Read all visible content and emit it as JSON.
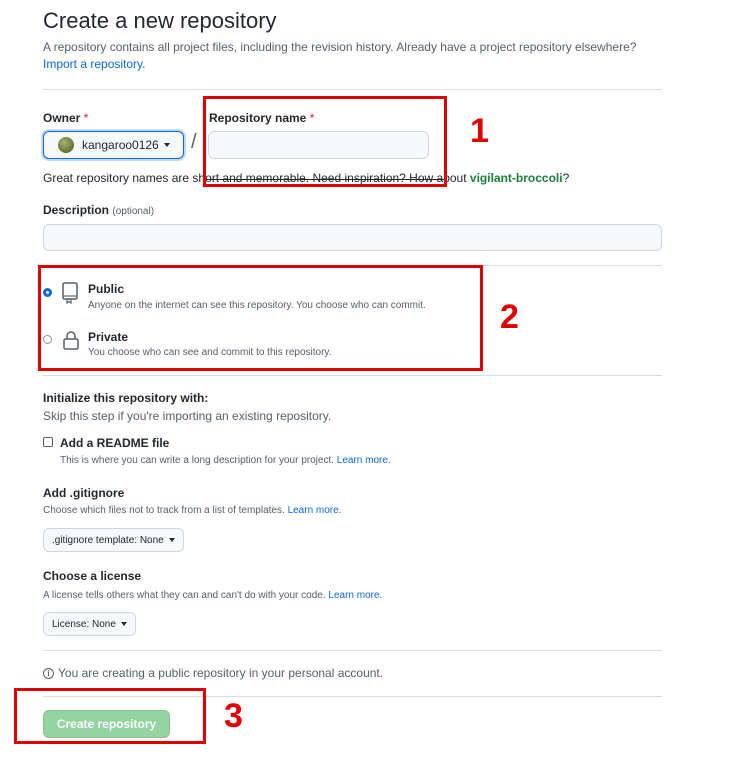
{
  "header": {
    "title": "Create a new repository",
    "description": "A repository contains all project files, including the revision history. Already have a project repository elsewhere?",
    "import_link": "Import a repository."
  },
  "owner": {
    "label": "Owner",
    "required_mark": "*",
    "value": "kangaroo0126"
  },
  "repo_name": {
    "label": "Repository name",
    "required_mark": "*",
    "separator": "/",
    "value": ""
  },
  "name_hint": {
    "text": "Great repository names are short and memorable. Need inspiration? How about ",
    "suggestion": "vigilant-broccoli",
    "suffix": "?"
  },
  "description": {
    "label": "Description",
    "optional": "(optional)",
    "value": ""
  },
  "visibility": {
    "selected": "public",
    "options": [
      {
        "id": "public",
        "title": "Public",
        "desc": "Anyone on the internet can see this repository. You choose who can commit."
      },
      {
        "id": "private",
        "title": "Private",
        "desc": "You choose who can see and commit to this repository."
      }
    ]
  },
  "initialize": {
    "heading": "Initialize this repository with:",
    "subtext": "Skip this step if you're importing an existing repository.",
    "readme_label": "Add a README file",
    "readme_desc": "This is where you can write a long description for your project.",
    "readme_checked": false,
    "learn_more": "Learn more."
  },
  "gitignore": {
    "heading": "Add .gitignore",
    "desc": "Choose which files not to track from a list of templates.",
    "learn_more": "Learn more.",
    "select_label": ".gitignore template: None"
  },
  "license": {
    "heading": "Choose a license",
    "desc": "A license tells others what they can and can't do with your code.",
    "learn_more": "Learn more.",
    "select_label": "License: None"
  },
  "info": {
    "icon_text": "i",
    "text": "You are creating a public repository in your personal account."
  },
  "submit": {
    "label": "Create repository"
  },
  "annotations": [
    {
      "number": "1"
    },
    {
      "number": "2"
    },
    {
      "number": "3"
    }
  ],
  "colors": {
    "annotation": "#e00000",
    "link": "#0969da",
    "suggestion": "#1a7f37",
    "create_button": "#94d3a2"
  }
}
